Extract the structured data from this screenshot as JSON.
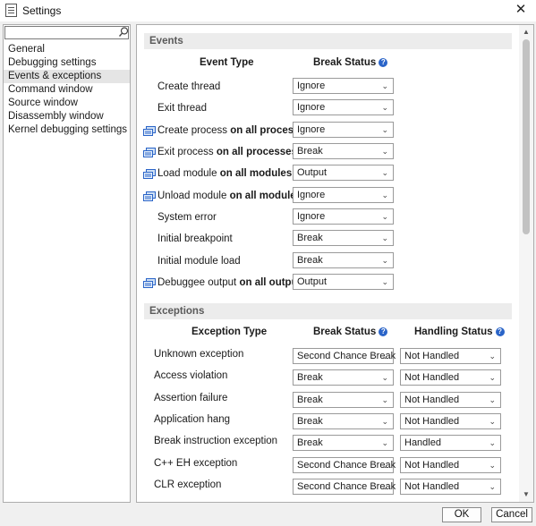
{
  "window": {
    "title": "Settings",
    "close_glyph": "✕"
  },
  "nav": {
    "search": {
      "value": "",
      "placeholder": ""
    },
    "items": [
      {
        "label": "General"
      },
      {
        "label": "Debugging settings"
      },
      {
        "label": "Events & exceptions",
        "selected": true
      },
      {
        "label": "Command window"
      },
      {
        "label": "Source window"
      },
      {
        "label": "Disassembly window"
      },
      {
        "label": "Kernel debugging settings"
      }
    ]
  },
  "events": {
    "section_title": "Events",
    "col_type": "Event Type",
    "col_break": "Break Status",
    "rows": [
      {
        "label": "Create thread",
        "break": "Ignore",
        "multi": false
      },
      {
        "label": "Exit thread",
        "break": "Ignore",
        "multi": false
      },
      {
        "label": "Create process",
        "scope": "on all processes",
        "break": "Ignore",
        "multi": true
      },
      {
        "label": "Exit process",
        "scope": "on all processes",
        "break": "Break",
        "multi": true
      },
      {
        "label": "Load module",
        "scope": "on all modules",
        "break": "Output",
        "multi": true
      },
      {
        "label": "Unload module",
        "scope": "on all modules",
        "break": "Ignore",
        "multi": true
      },
      {
        "label": "System error",
        "break": "Ignore",
        "multi": false
      },
      {
        "label": "Initial breakpoint",
        "break": "Break",
        "multi": false
      },
      {
        "label": "Initial module load",
        "break": "Break",
        "multi": false
      },
      {
        "label": "Debuggee output",
        "scope": "on all output",
        "break": "Output",
        "multi": true
      }
    ]
  },
  "exceptions": {
    "section_title": "Exceptions",
    "col_type": "Exception Type",
    "col_break": "Break Status",
    "col_handling": "Handling Status",
    "rows": [
      {
        "label": "Unknown exception",
        "break": "Second Chance Break",
        "handling": "Not Handled"
      },
      {
        "label": "Access violation",
        "break": "Break",
        "handling": "Not Handled"
      },
      {
        "label": "Assertion failure",
        "break": "Break",
        "handling": "Not Handled"
      },
      {
        "label": "Application hang",
        "break": "Break",
        "handling": "Not Handled"
      },
      {
        "label": "Break instruction exception",
        "break": "Break",
        "handling": "Handled"
      },
      {
        "label": "C++ EH exception",
        "break": "Second Chance Break",
        "handling": "Not Handled"
      },
      {
        "label": "CLR exception",
        "break": "Second Chance Break",
        "handling": "Not Handled"
      }
    ]
  },
  "buttons": {
    "ok": "OK",
    "cancel": "Cancel"
  },
  "icons": {
    "info": "info-icon",
    "chevron": "chevron-down-icon",
    "multi": "multi-target-icon",
    "search": "search-icon",
    "close": "close-icon"
  },
  "colors": {
    "accent": "#2a64c8",
    "section_bg": "#ececec",
    "selected_bg": "#e5e5e5"
  }
}
